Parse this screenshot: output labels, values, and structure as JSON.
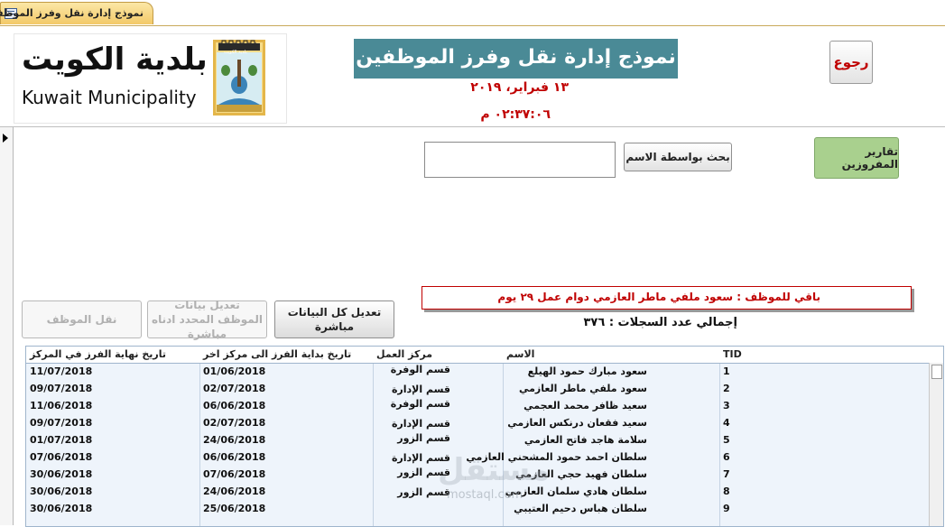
{
  "tab": {
    "title": "نموذج إدارة نقل وفرز الموظفين"
  },
  "header": {
    "logo_ar": "بلدية الكويت",
    "logo_en": "Kuwait Municipality",
    "emblem_caption": "بلدية الكويت",
    "title": "نموذج إدارة نقل وفرز الموظفين",
    "date": "١٣ فبراير، ٢٠١٩",
    "time": "٠٢:٣٧:٠٦ م",
    "back_label": "رجوع"
  },
  "search": {
    "value": "",
    "button_label": "بحث بواسطة الاسم"
  },
  "reports_label": "تقارير المفروزين",
  "notice": "باقي للموظف : سعود ملفي ماطر العازمي دوام عمل ٢٩ يوم",
  "record_count": "إجمالي عدد السجلات : ٣٧٦",
  "actions": {
    "move_employee": "نقل الموظف",
    "edit_selected": "تعديل بيانات الموظف المحدد ادناه مباشرة",
    "edit_all": "تعديل كل البيانات مباشرة"
  },
  "grid": {
    "columns": {
      "tid": "TID",
      "name": "الاسم",
      "center": "مركز العمل",
      "start": "تاريخ بداية الفرز الى مركز اخر",
      "end": "تاريخ نهاية  الفرز في المركز"
    },
    "rows": [
      {
        "tid": "1",
        "name": "سعود مبارك حمود الهيلع",
        "center": "قسم الوفرة",
        "start": "01/06/2018",
        "end": "11/07/2018"
      },
      {
        "tid": "2",
        "name": "سعود ملفي ماطر العازمي",
        "center": "قسم الإدارة",
        "start": "02/07/2018",
        "end": "09/07/2018"
      },
      {
        "tid": "3",
        "name": "سعيد ظافر محمد العجمي",
        "center": "قسم الوفرة",
        "start": "06/06/2018",
        "end": "11/06/2018"
      },
      {
        "tid": "4",
        "name": "سعيد فقعان درنكس العازمي",
        "center": "قسم الإدارة",
        "start": "02/07/2018",
        "end": "09/07/2018"
      },
      {
        "tid": "5",
        "name": "سلامة هاجد فاتح العازمي",
        "center": "قسم الزور",
        "start": "24/06/2018",
        "end": "01/07/2018"
      },
      {
        "tid": "6",
        "name": "سلطان احمد حمود المشحني العازمي",
        "center": "قسم الإدارة",
        "start": "06/06/2018",
        "end": "07/06/2018"
      },
      {
        "tid": "7",
        "name": "سلطان فهيد حجي العازمي",
        "center": "قسم الزور",
        "start": "07/06/2018",
        "end": "30/06/2018"
      },
      {
        "tid": "8",
        "name": "سلطان هادي سلمان العازمي",
        "center": "قسم الزور",
        "start": "24/06/2018",
        "end": "30/06/2018"
      },
      {
        "tid": "9",
        "name": "سلطان هباس دحيم العتيبي",
        "center": "",
        "start": "25/06/2018",
        "end": "30/06/2018"
      }
    ]
  },
  "watermark": {
    "ar": "مستقل",
    "en": "mostaql.com"
  },
  "colors": {
    "title_bg": "#4a8a96",
    "accent_red": "#c00000",
    "reports_bg": "#a9d08e",
    "grid_bg": "#eef4fb"
  }
}
